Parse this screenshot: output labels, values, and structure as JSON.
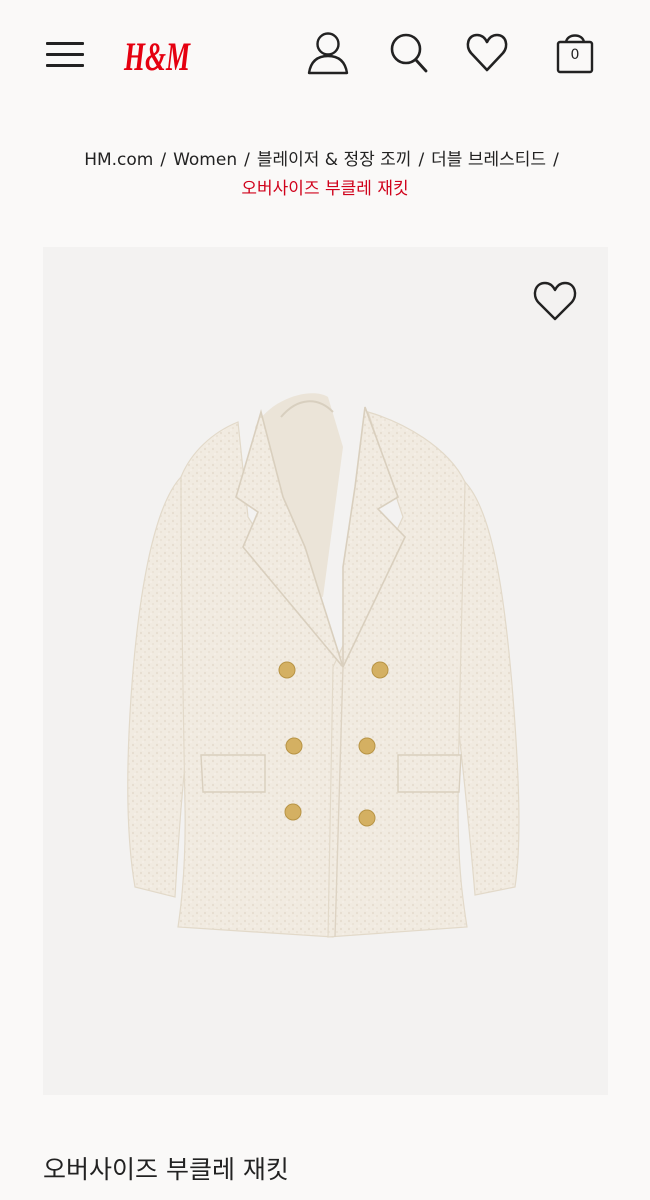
{
  "header": {
    "logo_text": "H&M",
    "cart_count": "0",
    "brand_color": "#e50010",
    "icon_names": [
      "menu-icon",
      "user-icon",
      "search-icon",
      "heart-icon",
      "shopping-bag-icon"
    ]
  },
  "breadcrumb": {
    "items": [
      "HM.com",
      "Women",
      "블레이저 & 정장 조끼",
      "더블 브레스티드"
    ],
    "separator": "/",
    "current": "오버사이즈 부클레 재킷",
    "current_color": "#d0021b"
  },
  "product": {
    "title": "오버사이즈 부클레 재킷",
    "image_background": "#f3f2f1",
    "jacket_color": "#f1ebe1",
    "button_color": "#d4b062"
  }
}
